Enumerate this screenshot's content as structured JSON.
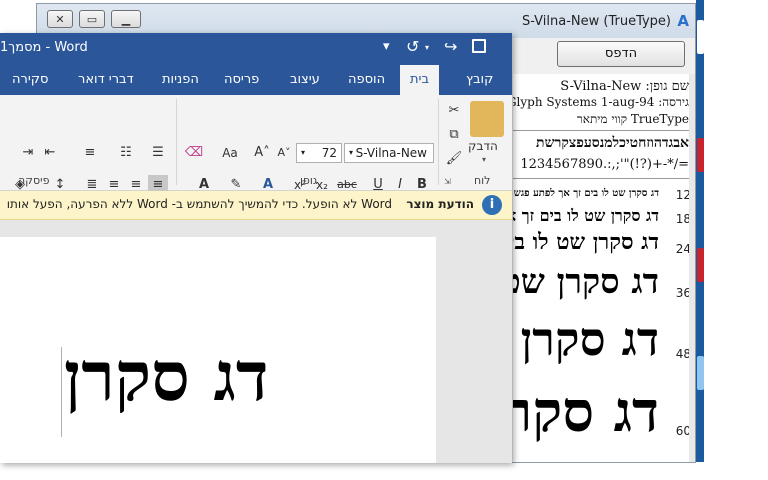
{
  "font_viewer": {
    "title": "S-Vilna-New (TrueType)",
    "print_label": "הדפס",
    "info": {
      "font_name_line": "שם גופן: S-Vilna-New",
      "version_line": "גירסה: Glyph Systems 1-aug-94",
      "type_line": "TrueType קווי מיתאר"
    },
    "alphabet_line": "אבגדהוזחטיכלמנסעפצקרשת",
    "digits_line": "1234567890.:,;'\"(!?)+-*/=",
    "sample_text": "דג סקרן שט לו בים זך אך לפתע פגש חבורה נחמדה",
    "sizes": [
      "12",
      "18",
      "24",
      "36",
      "48",
      "60"
    ]
  },
  "word": {
    "title": "מסמך1 - Word",
    "tabs": [
      "קובץ",
      "בית",
      "הוספה",
      "עיצוב",
      "פריסה",
      "הפניות",
      "דברי דואר",
      "סקירה"
    ],
    "active_tab": "בית",
    "font_name": "S-Vilna-New",
    "font_size": "72",
    "groups": {
      "clipboard": "לוח",
      "font": "גופן",
      "paragraph": "פיסקה"
    },
    "paste_label": "הדבק",
    "message": {
      "title": "הודעת מוצר",
      "text": "Word לא הופעל. כדי להמשיך להשתמש ב- Word ללא הפרעה, הפעל אותו"
    },
    "document_text": "דג סקרן",
    "font_buttons": {
      "bold": "B",
      "italic": "I",
      "underline": "U",
      "strikethrough": "abc",
      "subscript": "x₂",
      "superscript": "x²",
      "clear": "Aa"
    }
  },
  "colors": {
    "word_blue": "#2b579a",
    "message_bg": "#fdf5c9",
    "info_icon": "#2e6fb6"
  }
}
